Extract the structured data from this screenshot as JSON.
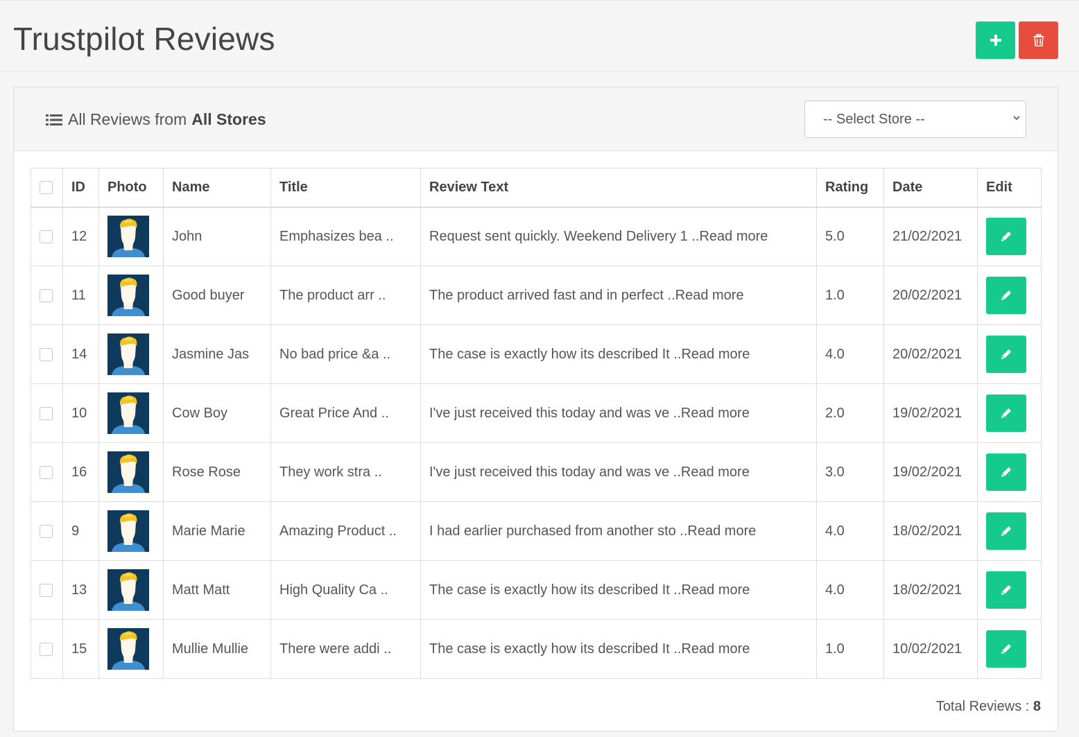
{
  "header": {
    "title": "Trustpilot Reviews",
    "add_icon": "plus-icon",
    "delete_icon": "trash-icon"
  },
  "panel": {
    "heading_prefix": "All Reviews from",
    "heading_bold": "All Stores",
    "store_select": {
      "value": "-- Select Store --"
    }
  },
  "table": {
    "columns": {
      "id": "ID",
      "photo": "Photo",
      "name": "Name",
      "title": "Title",
      "text": "Review Text",
      "rating": "Rating",
      "date": "Date",
      "edit": "Edit"
    },
    "rows": [
      {
        "id": "12",
        "name": "John",
        "title": "Emphasizes bea ..",
        "text": "Request sent quickly. Weekend Delivery 1 ..Read more",
        "rating": "5.0",
        "date": "21/02/2021"
      },
      {
        "id": "11",
        "name": "Good buyer",
        "title": "The product arr ..",
        "text": "The product arrived fast and in perfect ..Read more",
        "rating": "1.0",
        "date": "20/02/2021"
      },
      {
        "id": "14",
        "name": "Jasmine Jas",
        "title": "No bad price &a ..",
        "text": "The case is exactly how its described It ..Read more",
        "rating": "4.0",
        "date": "20/02/2021"
      },
      {
        "id": "10",
        "name": "Cow Boy",
        "title": "Great Price And ..",
        "text": "I've just received this today and was ve ..Read more",
        "rating": "2.0",
        "date": "19/02/2021"
      },
      {
        "id": "16",
        "name": "Rose Rose",
        "title": "They work stra ..",
        "text": "I've just received this today and was ve ..Read more",
        "rating": "3.0",
        "date": "19/02/2021"
      },
      {
        "id": "9",
        "name": "Marie Marie",
        "title": "Amazing Product ..",
        "text": "I had earlier purchased from another sto ..Read more",
        "rating": "4.0",
        "date": "18/02/2021"
      },
      {
        "id": "13",
        "name": "Matt Matt",
        "title": "High Quality Ca ..",
        "text": "The case is exactly how its described It ..Read more",
        "rating": "4.0",
        "date": "18/02/2021"
      },
      {
        "id": "15",
        "name": "Mullie Mullie",
        "title": "There were addi ..",
        "text": "The case is exactly how its described It ..Read more",
        "rating": "1.0",
        "date": "10/02/2021"
      }
    ]
  },
  "footer": {
    "total_label": "Total Reviews :",
    "total_count": "8"
  },
  "colors": {
    "accent_green": "#16c98d",
    "danger_red": "#e74c3c",
    "avatar_bg": "#0f3a5c"
  }
}
